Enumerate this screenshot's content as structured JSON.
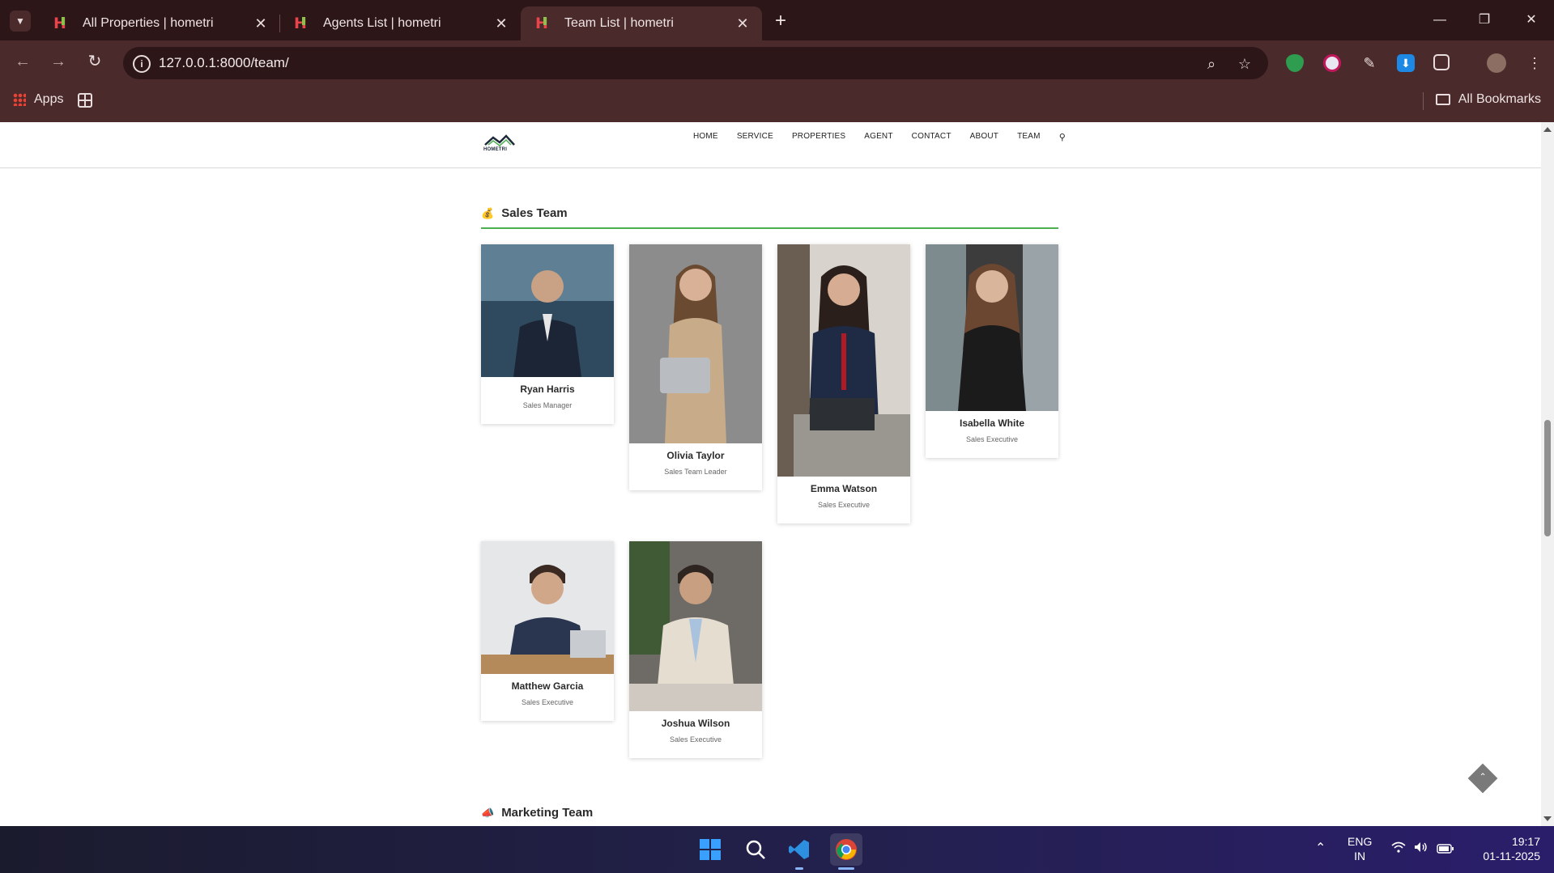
{
  "browser": {
    "tabs": [
      {
        "title": "All Properties | hometri",
        "active": false
      },
      {
        "title": "Agents List | hometri",
        "active": false
      },
      {
        "title": "Team List | hometri",
        "active": true
      }
    ],
    "url": "127.0.0.1:8000/team/",
    "bookmarks": {
      "apps_label": "Apps",
      "all_bookmarks_label": "All Bookmarks"
    }
  },
  "site": {
    "logo_text": "HOMETRI",
    "nav": [
      "HOME",
      "SERVICE",
      "PROPERTIES",
      "AGENT",
      "CONTACT",
      "ABOUT",
      "TEAM"
    ]
  },
  "sections": [
    {
      "title": "Sales Team",
      "emoji": "💰",
      "members": [
        {
          "name": "Ryan Harris",
          "role": "Sales Manager"
        },
        {
          "name": "Olivia Taylor",
          "role": "Sales Team Leader"
        },
        {
          "name": "Emma Watson",
          "role": "Sales Executive"
        },
        {
          "name": "Isabella White",
          "role": "Sales Executive"
        },
        {
          "name": "Matthew Garcia",
          "role": "Sales Executive"
        },
        {
          "name": "Joshua Wilson",
          "role": "Sales Executive"
        }
      ]
    },
    {
      "title": "Marketing Team",
      "emoji": "📣",
      "members": []
    }
  ],
  "taskbar": {
    "lang_primary": "ENG",
    "lang_secondary": "IN",
    "time": "19:17",
    "date": "01-11-2025"
  },
  "colors": {
    "tab_bar": "#2c1618",
    "toolbar": "#4a2a2b",
    "section_rule": "#4caf50"
  }
}
